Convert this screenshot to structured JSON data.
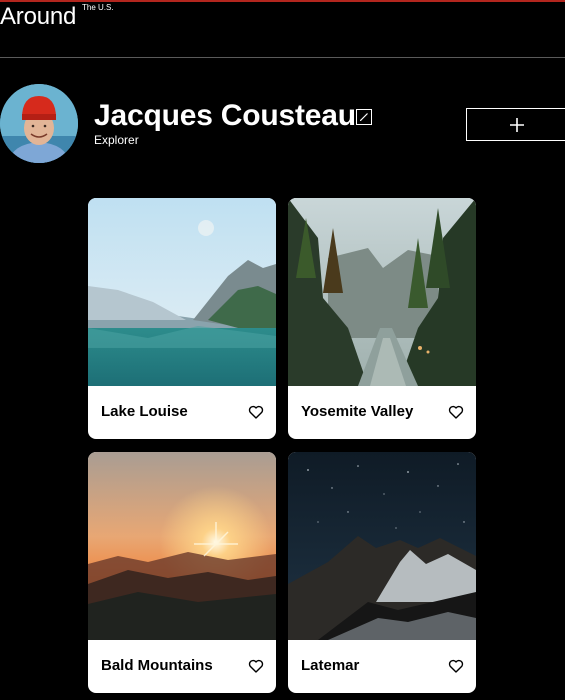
{
  "header": {
    "logo_text": "Around",
    "logo_superscript": "The U.S."
  },
  "profile": {
    "name": "Jacques Cousteau",
    "role": "Explorer"
  },
  "cards": [
    {
      "title": "Lake Louise"
    },
    {
      "title": "Yosemite Valley"
    },
    {
      "title": "Bald Mountains"
    },
    {
      "title": "Latemar"
    }
  ],
  "icons": {
    "edit": "edit-icon",
    "add": "plus-icon",
    "like": "heart-outline-icon"
  },
  "colors": {
    "background": "#000000",
    "accent_top_line": "#b3261e",
    "card_bg": "#ffffff",
    "text_light": "#ffffff",
    "text_dark": "#000000"
  }
}
